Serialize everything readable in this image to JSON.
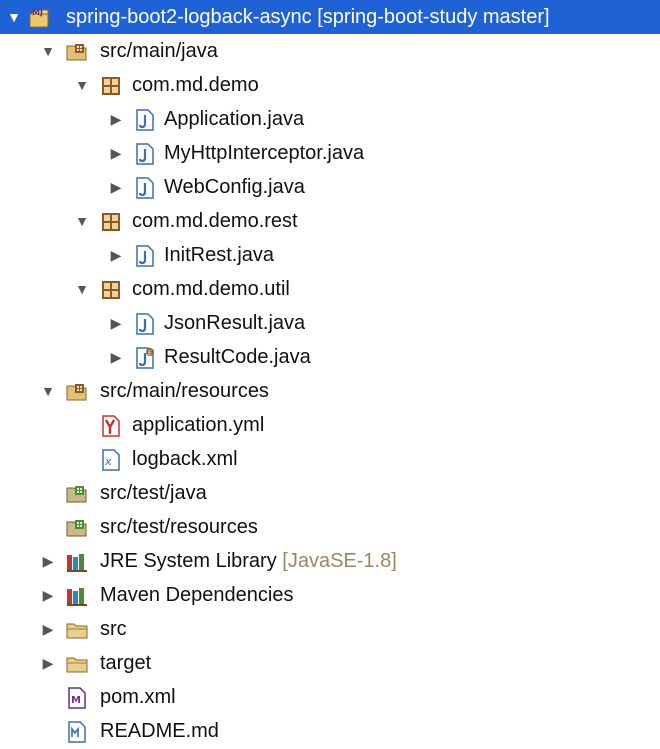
{
  "tree": {
    "items": [
      {
        "label": "spring-boot2-logback-async [spring-boot-study master]",
        "icon": "maven-project-icon",
        "twisty": "▼"
      },
      {
        "label": "src/main/java",
        "icon": "source-folder-icon",
        "twisty": "▼"
      },
      {
        "label": "com.md.demo",
        "icon": "package-icon",
        "twisty": "▼"
      },
      {
        "label": "Application.java",
        "icon": "java-file-icon",
        "twisty": "▶"
      },
      {
        "label": "MyHttpInterceptor.java",
        "icon": "java-file-icon",
        "twisty": "▶"
      },
      {
        "label": "WebConfig.java",
        "icon": "java-file-icon",
        "twisty": "▶"
      },
      {
        "label": "com.md.demo.rest",
        "icon": "package-icon",
        "twisty": "▼"
      },
      {
        "label": "InitRest.java",
        "icon": "java-file-icon",
        "twisty": "▶"
      },
      {
        "label": "com.md.demo.util",
        "icon": "package-icon",
        "twisty": "▼"
      },
      {
        "label": "JsonResult.java",
        "icon": "java-file-icon",
        "twisty": "▶"
      },
      {
        "label": "ResultCode.java",
        "icon": "java-enum-file-icon",
        "twisty": "▶"
      },
      {
        "label": "src/main/resources",
        "icon": "source-folder-icon",
        "twisty": "▼"
      },
      {
        "label": "application.yml",
        "icon": "yaml-file-icon",
        "twisty": ""
      },
      {
        "label": "logback.xml",
        "icon": "xml-file-icon",
        "twisty": ""
      },
      {
        "label": "src/test/java",
        "icon": "source-folder-icon",
        "twisty": ""
      },
      {
        "label": "src/test/resources",
        "icon": "source-folder-icon",
        "twisty": ""
      },
      {
        "label": "JRE System Library",
        "decoration": "[JavaSE-1.8]",
        "icon": "library-icon",
        "twisty": "▶"
      },
      {
        "label": "Maven Dependencies",
        "icon": "library-icon",
        "twisty": "▶"
      },
      {
        "label": "src",
        "icon": "folder-icon",
        "twisty": "▶"
      },
      {
        "label": "target",
        "icon": "folder-icon",
        "twisty": "▶"
      },
      {
        "label": "pom.xml",
        "icon": "maven-pom-icon",
        "twisty": ""
      },
      {
        "label": "README.md",
        "icon": "markdown-file-icon",
        "twisty": ""
      }
    ]
  },
  "colors": {
    "selection": "#1f62d6",
    "decoration": "#9a8762",
    "java_blue": "#3c6fb0",
    "package_brown": "#8a5a2b",
    "folder_tan": "#e2c07a",
    "yaml_red": "#c8302c",
    "library_green": "#4d8a3a"
  }
}
